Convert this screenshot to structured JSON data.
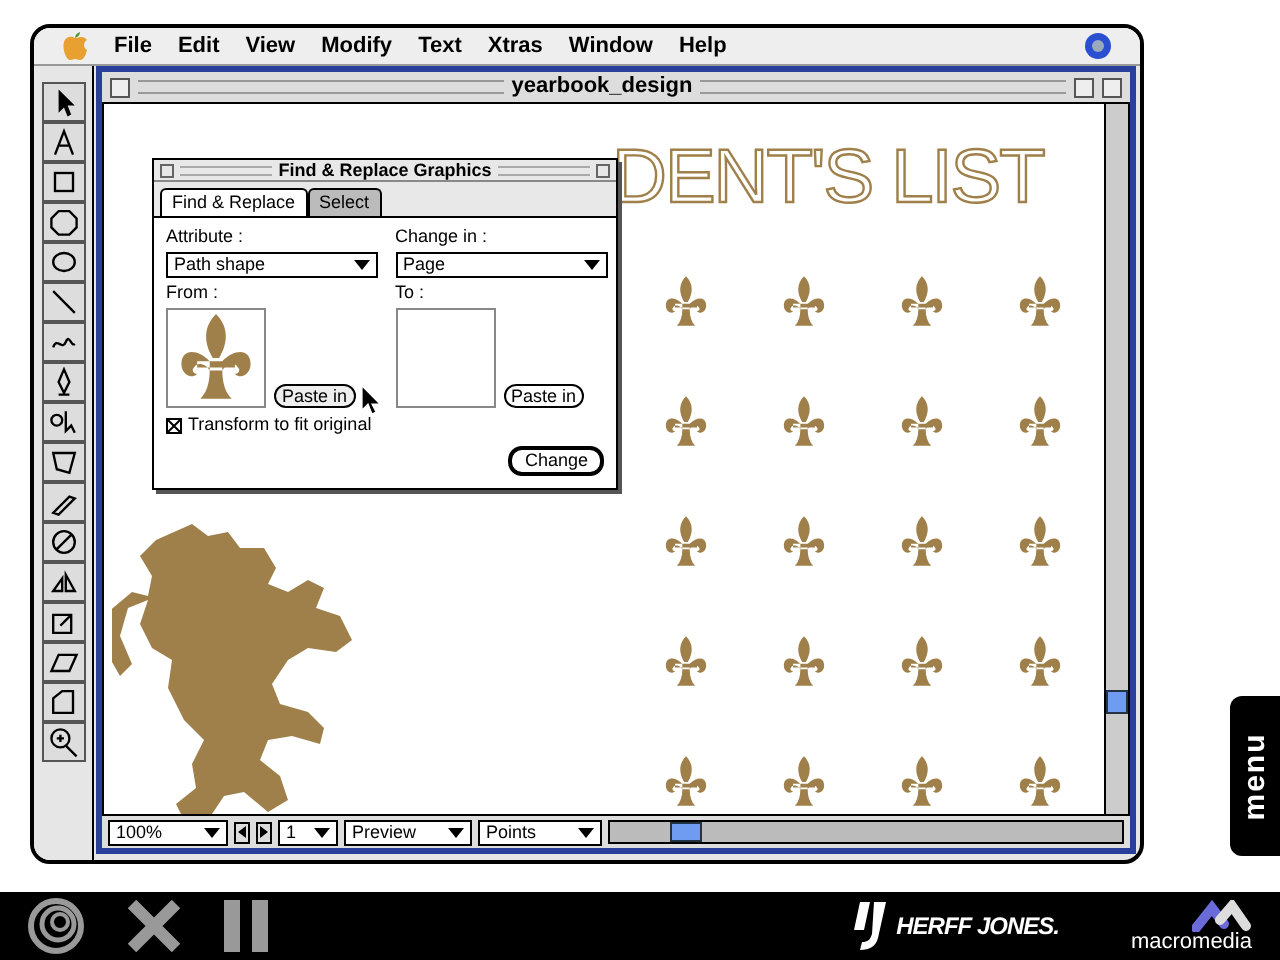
{
  "menubar": {
    "items": [
      "File",
      "Edit",
      "View",
      "Modify",
      "Text",
      "Xtras",
      "Window",
      "Help"
    ]
  },
  "document": {
    "title": "yearbook_design",
    "heading": "DENT'S LIST"
  },
  "dialog": {
    "title": "Find & Replace Graphics",
    "tabs": [
      {
        "label": "Find & Replace",
        "selected": true
      },
      {
        "label": "Select",
        "selected": false
      }
    ],
    "attribute": {
      "label": "Attribute :",
      "value": "Path shape"
    },
    "change_in": {
      "label": "Change in :",
      "value": "Page"
    },
    "from": {
      "label": "From :",
      "button": "Paste in"
    },
    "to": {
      "label": "To :",
      "button": "Paste in"
    },
    "transform": {
      "label": "Transform to fit original",
      "checked": true
    },
    "change_button": "Change"
  },
  "status_bar": {
    "zoom": "100%",
    "page": "1",
    "view": "Preview",
    "units": "Points"
  },
  "menu_tab": "menu",
  "footer": {
    "brand": "HERFF JONES.",
    "maker": "macromedia"
  }
}
